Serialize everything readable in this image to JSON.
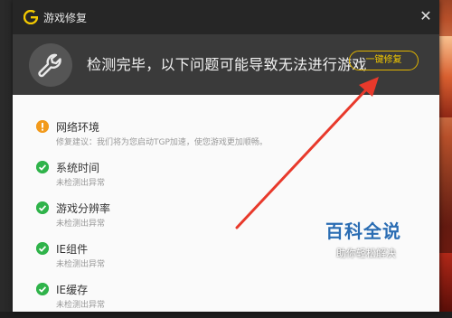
{
  "window": {
    "title": "游戏修复",
    "close_glyph": "✕"
  },
  "banner": {
    "message": "检测完毕，以下问题可能导致无法进行游戏",
    "repair_button": "一键修复",
    "accent_color": "#f3c900"
  },
  "items": [
    {
      "title": "网络环境",
      "desc": "修复建议：我们将为您启动TGP加速，使您游戏更加顺畅。",
      "status": "warning"
    },
    {
      "title": "系统时间",
      "desc": "未检测出异常",
      "status": "ok"
    },
    {
      "title": "游戏分辨率",
      "desc": "未检测出异常",
      "status": "ok"
    },
    {
      "title": "IE组件",
      "desc": "未检测出异常",
      "status": "ok"
    },
    {
      "title": "IE缓存",
      "desc": "未检测出异常",
      "status": "ok"
    }
  ],
  "watermark": {
    "logo": "百科全说",
    "tagline": "助你轻松解决"
  }
}
